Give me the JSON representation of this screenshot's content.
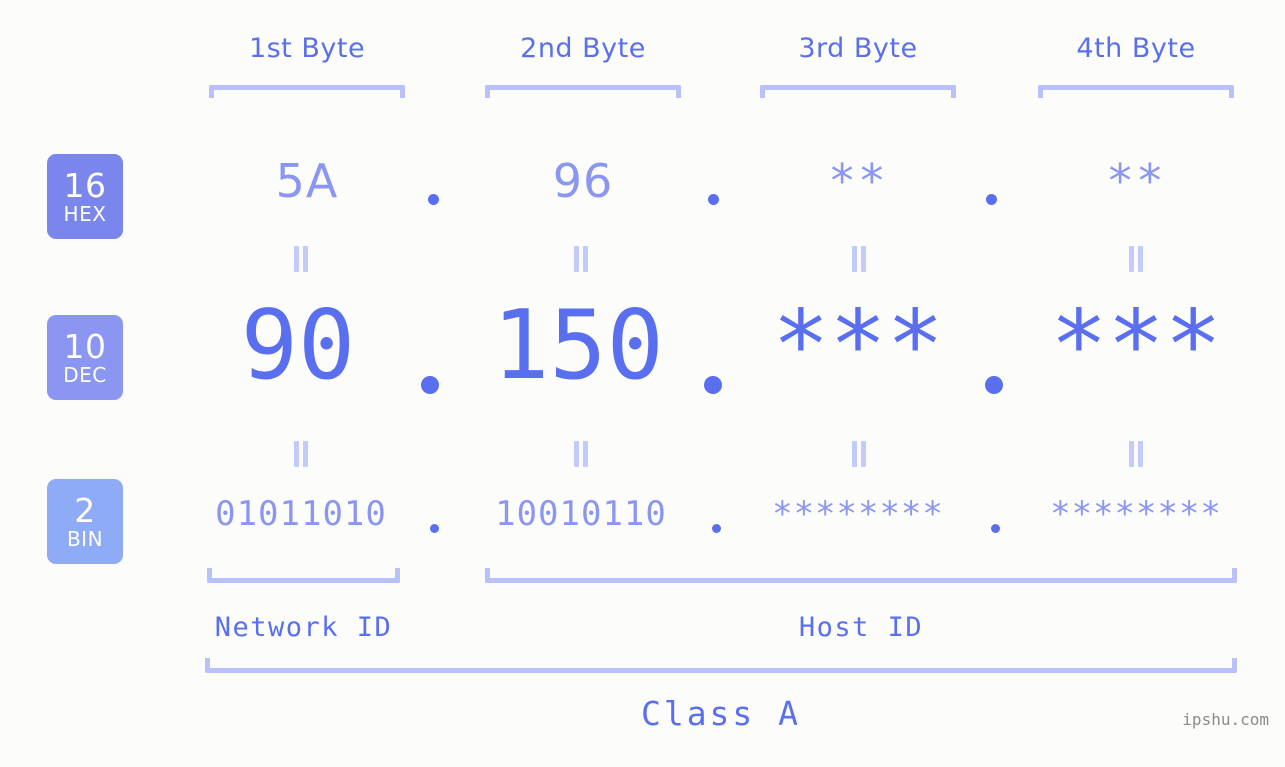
{
  "background_color": "#fcfdfa",
  "accent_strong": "#5a6ff0",
  "accent_mid": "#8b96f2",
  "accent_light": "#b8c1fb",
  "byte_headers": [
    {
      "label": "1st Byte"
    },
    {
      "label": "2nd Byte"
    },
    {
      "label": "3rd Byte"
    },
    {
      "label": "4th Byte"
    }
  ],
  "radix_badges": [
    {
      "number": "16",
      "name": "HEX",
      "color": "#7b86ec"
    },
    {
      "number": "10",
      "name": "DEC",
      "color": "#8b96f2"
    },
    {
      "number": "2",
      "name": "BIN",
      "color": "#8fabf5"
    }
  ],
  "rows": {
    "hex": {
      "radix": "16",
      "radix_name": "HEX",
      "values": [
        "5A",
        "96",
        "**",
        "**"
      ],
      "separator": "."
    },
    "dec": {
      "radix": "10",
      "radix_name": "DEC",
      "values": [
        "90",
        "150",
        "***",
        "***"
      ],
      "separator": "."
    },
    "bin": {
      "radix": "2",
      "radix_name": "BIN",
      "values": [
        "01011010",
        "10010110",
        "********",
        "********"
      ],
      "separator": "."
    }
  },
  "equivalence_symbol": "=",
  "sections": {
    "network_id": "Network ID",
    "host_id": "Host ID",
    "class": "Class A"
  },
  "watermark": "ipshu.com"
}
